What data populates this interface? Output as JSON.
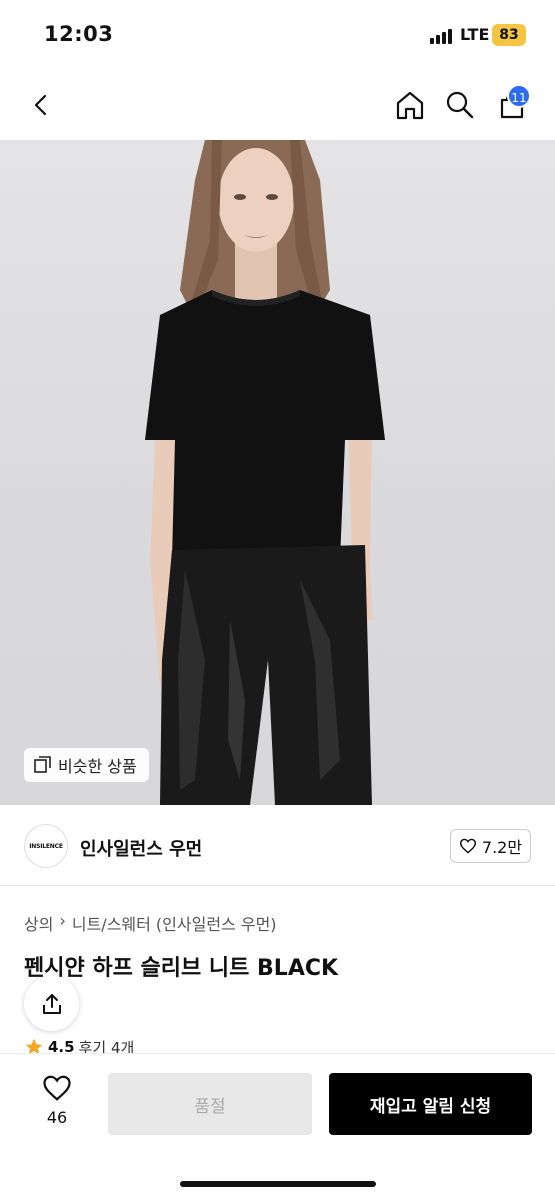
{
  "status_bar": {
    "time": "12:03",
    "network": "LTE",
    "battery": "83"
  },
  "nav": {
    "cart_count": "11",
    "icons": [
      "back-arrow-icon",
      "home-icon",
      "search-icon",
      "shopping-bag-icon"
    ]
  },
  "hero": {
    "similar_label": "비슷한 상품"
  },
  "brand": {
    "logo_text": "INSILENCE",
    "name": "인사일런스 우먼",
    "likes": "7.2만"
  },
  "breadcrumb": {
    "items": [
      "상의",
      "니트/스웨터 (인사일런스 우먼)"
    ]
  },
  "product": {
    "title": "펜시얀 하프 슬리브 니트 BLACK",
    "rating": "4.5",
    "reviews": "후기 4개"
  },
  "bottom": {
    "wish_count": "46",
    "soldout_label": "품절",
    "restock_label": "재입고 알림 신청"
  },
  "colors": {
    "accent_badge": "#2f6cf6",
    "primary_button": "#000000",
    "disabled_button": "#e8e8e8",
    "star": "#f5a623"
  }
}
